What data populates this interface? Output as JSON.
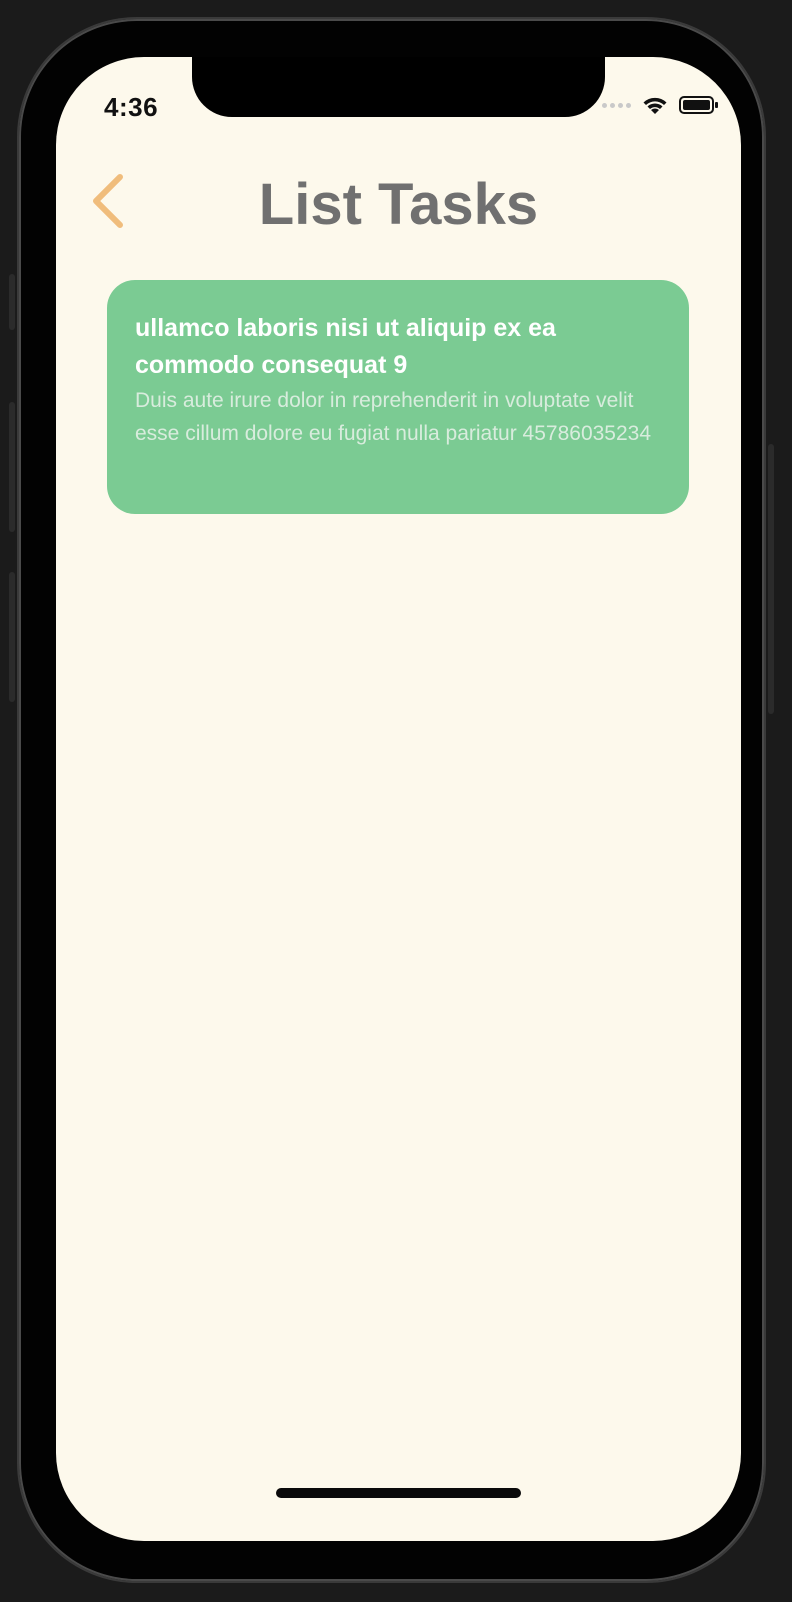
{
  "status_bar": {
    "time": "4:36"
  },
  "header": {
    "title": "List Tasks",
    "back_icon": "chevron-left-icon"
  },
  "tasks": [
    {
      "title": "ullamco laboris nisi ut aliquip ex ea commodo consequat 9",
      "description": "Duis aute irure dolor in reprehenderit in voluptate velit esse cillum dolore eu fugiat nulla pariatur 45786035234"
    }
  ],
  "colors": {
    "background": "#fdf9ec",
    "card": "#7bcb93",
    "title": "#707070",
    "back_accent": "#f0bd7c"
  }
}
